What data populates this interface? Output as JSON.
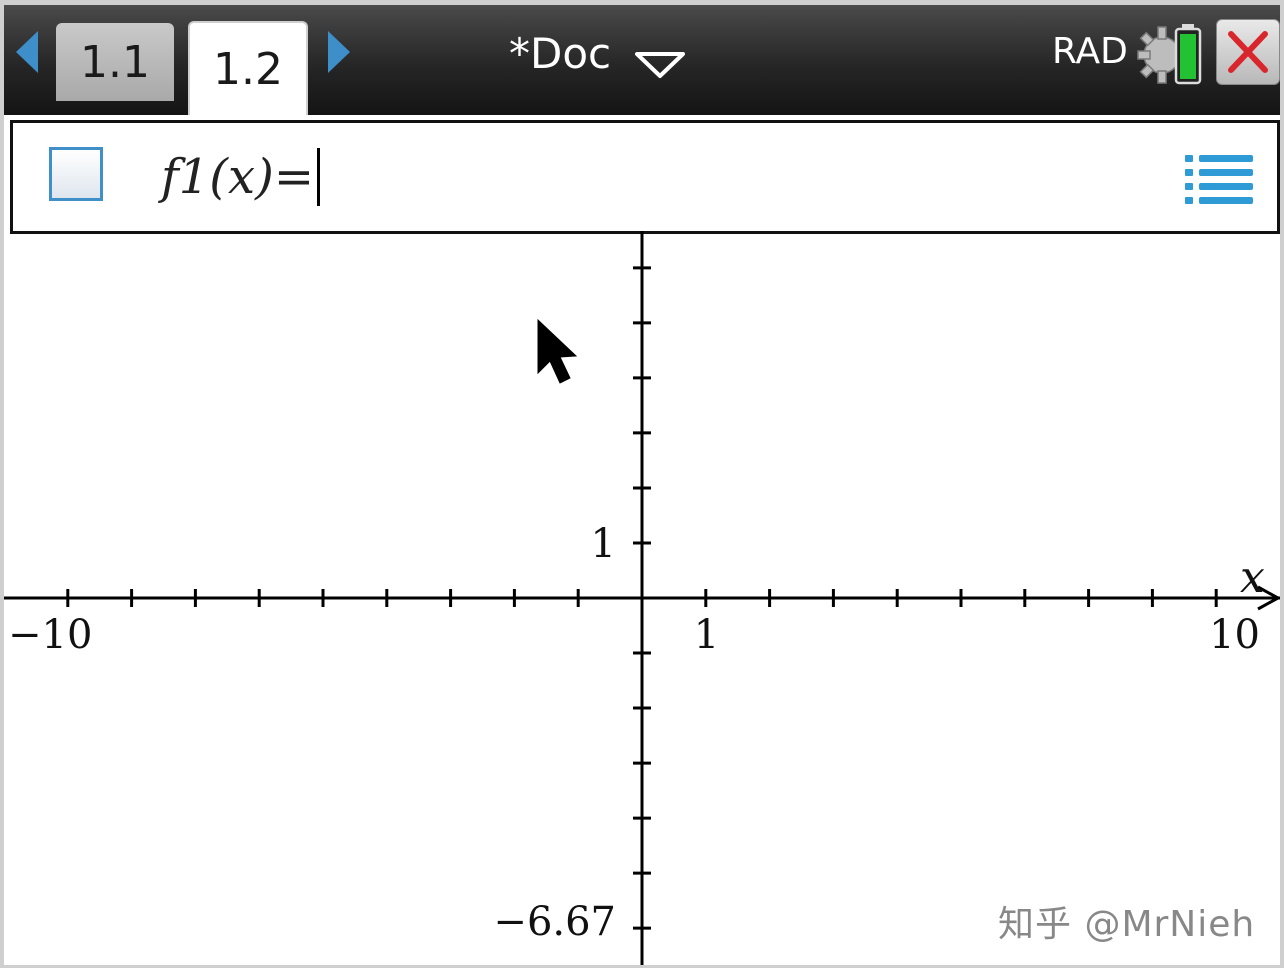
{
  "tabs": {
    "items": [
      {
        "label": "1.1",
        "active": false
      },
      {
        "label": "1.2",
        "active": true
      }
    ]
  },
  "document": {
    "title": "*Doc"
  },
  "status": {
    "angle_mode": "RAD"
  },
  "entry_line": {
    "expression": "f1(x)=",
    "value": ""
  },
  "chart_data": {
    "type": "line",
    "series": [],
    "xlim": [
      -10,
      10
    ],
    "ylim": [
      -6.67,
      6.67
    ],
    "x_var": "x",
    "x_tick_step": 1,
    "y_tick_step": 1,
    "labels": {
      "x_min": "−10",
      "x_max": "10",
      "x_unit": "1",
      "y_min": "−6.67",
      "y_unit": "1"
    },
    "grid": false
  },
  "watermark": "知乎 @MrNieh",
  "colors": {
    "accent": "#3d8ec9",
    "battery": "#22c232",
    "close": "#d8262c"
  }
}
